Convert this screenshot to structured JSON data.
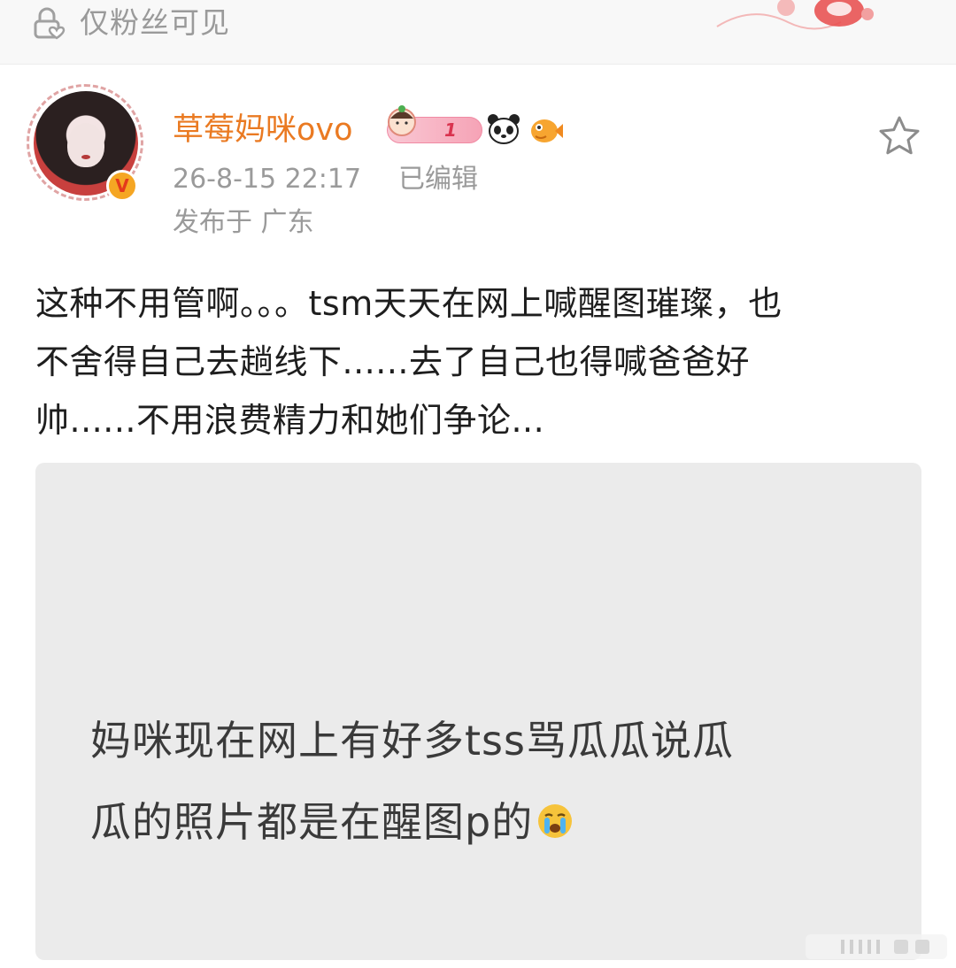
{
  "visibility": {
    "icon": "lock-heart-icon",
    "label": "仅粉丝可见"
  },
  "author": {
    "name": "草莓妈咪ovo",
    "verified_icon": "verified-v-badge-icon",
    "level": "1",
    "badges": [
      "level-badge-icon",
      "panda-icon",
      "fish-icon"
    ],
    "name_color": "#ea7a22"
  },
  "meta": {
    "time": "26-8-15 22:17",
    "edited": "已编辑",
    "location": "发布于 广东"
  },
  "actions": {
    "favorite_icon": "star-outline-icon"
  },
  "post": {
    "lines": [
      "这种不用管啊。。。tsm天天在网上喊醒图璀璨，也",
      "不舍得自己去趟线下......去了自己也得喊爸爸好",
      "帅......不用浪费精力和她们争论..."
    ]
  },
  "image": {
    "lines": [
      "妈咪现在网上有好多tss骂瓜瓜说瓜",
      "瓜的照片都是在醒图p的"
    ],
    "emoji": "crying-face-icon"
  }
}
